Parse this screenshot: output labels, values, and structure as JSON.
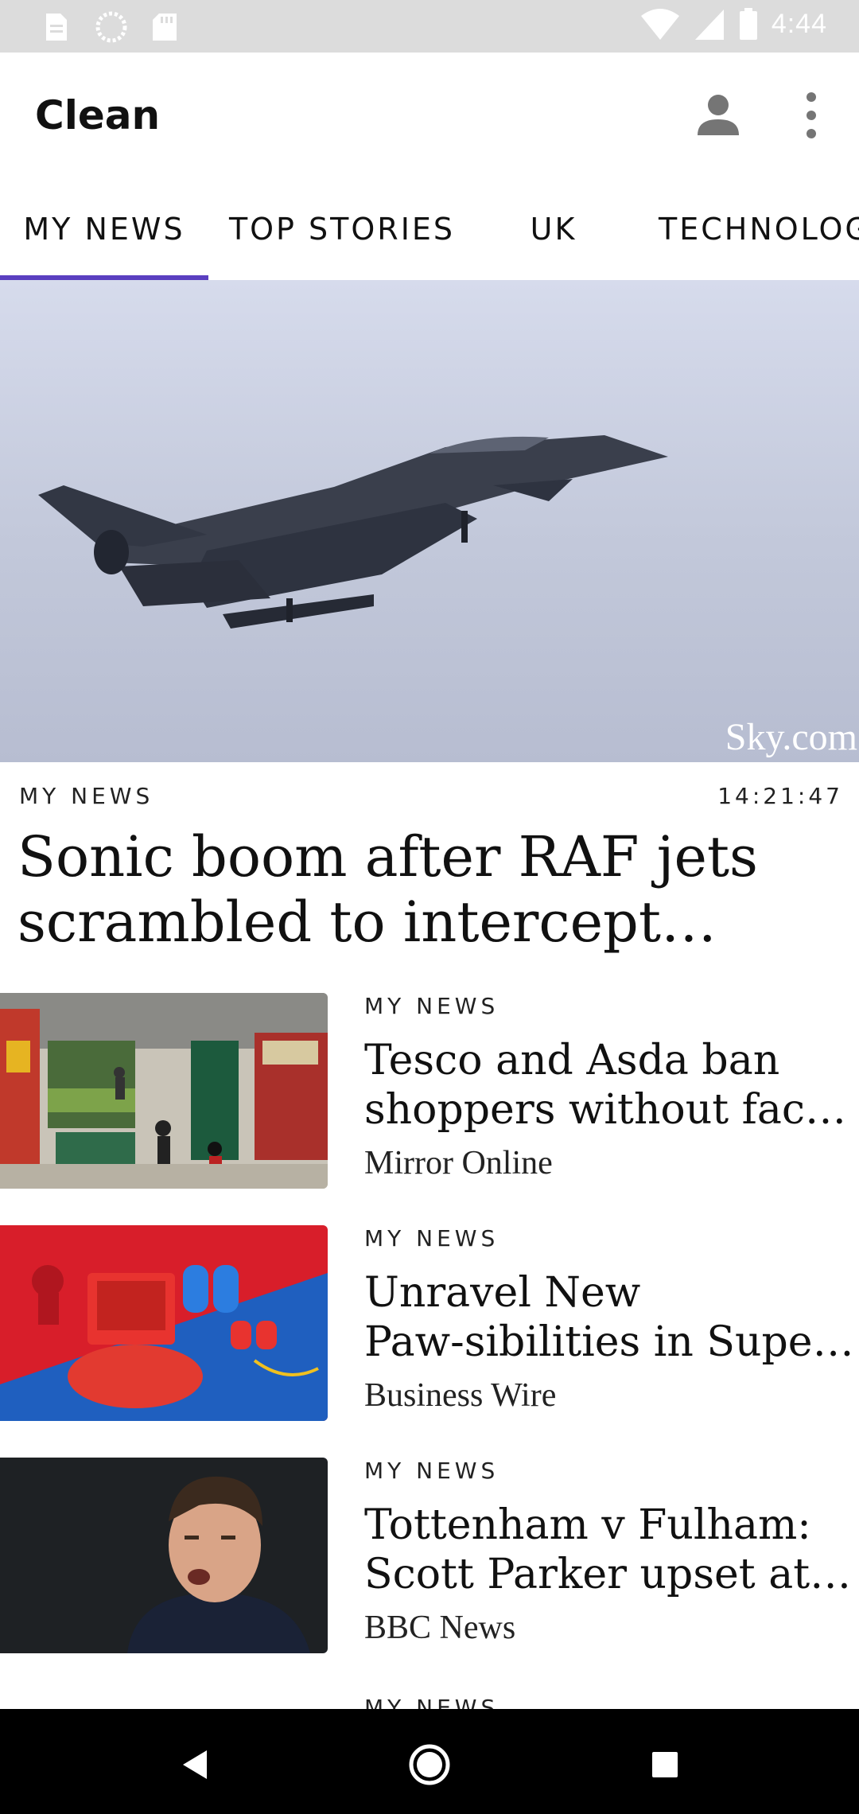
{
  "status_bar": {
    "time": "4:44",
    "left_icons": [
      "document-icon",
      "sync-icon",
      "sd-card-icon"
    ],
    "right_icons": [
      "wifi-icon",
      "signal-icon",
      "battery-icon"
    ]
  },
  "app_bar": {
    "title": "Clean",
    "account_icon": "person-icon",
    "more_icon": "more-vert-icon"
  },
  "tabs": [
    {
      "label": "MY NEWS",
      "selected": true
    },
    {
      "label": "TOP STORIES",
      "selected": false
    },
    {
      "label": "UK",
      "selected": false
    },
    {
      "label": "TECHNOLOGY",
      "selected": false
    }
  ],
  "accent_color": "#5a3fc0",
  "hero": {
    "image_credit": "Sky.com",
    "category": "MY NEWS",
    "time": "14:21:47",
    "title": "Sonic boom after RAF jets scrambled to intercept private jet"
  },
  "articles": [
    {
      "category": "MY NEWS",
      "title_line1": "Tesco and Asda ban",
      "title_line2": "shoppers without face masks",
      "source": "Mirror Online"
    },
    {
      "category": "MY NEWS",
      "title_line1": "Unravel New",
      "title_line2": "Paw-sibilities in Super Mario",
      "source": "Business Wire"
    },
    {
      "category": "MY NEWS",
      "title_line1": "Tottenham v Fulham:",
      "title_line2": "Scott Parker upset at side",
      "source": "BBC News"
    }
  ],
  "partial_item": {
    "category": "MY NEWS"
  },
  "nav_bar": {
    "back_icon": "back-triangle-icon",
    "home_icon": "home-circle-icon",
    "recents_icon": "recents-square-icon"
  }
}
